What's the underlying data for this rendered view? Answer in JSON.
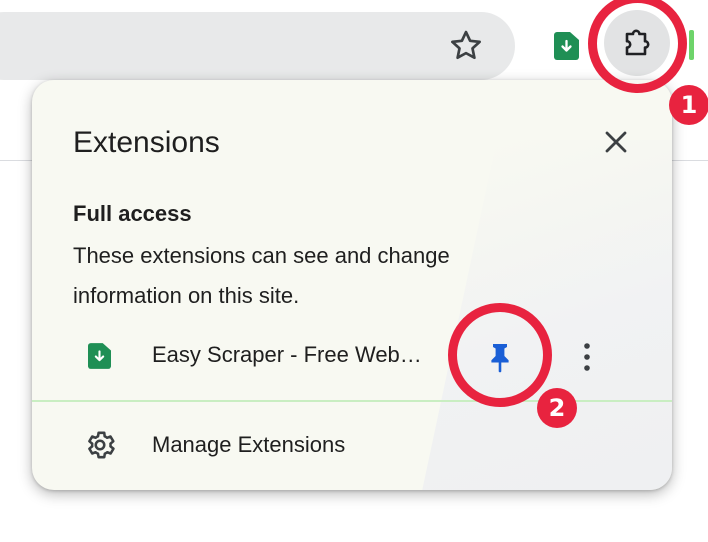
{
  "toolbar": {
    "bookmark_icon": "star-icon",
    "extension_icon": "easy-scraper-icon",
    "extensions_menu_icon": "puzzle-icon"
  },
  "popup": {
    "title": "Extensions",
    "close_icon": "close-icon",
    "section": {
      "heading": "Full access",
      "description": "These extensions can see and change information on this site."
    },
    "extensions": [
      {
        "name": "Easy Scraper - Free Web…",
        "icon": "easy-scraper-icon",
        "pin_icon": "pin-icon",
        "more_icon": "more-vert-icon"
      }
    ],
    "manage": {
      "label": "Manage Extensions",
      "icon": "gear-icon"
    }
  },
  "annotations": {
    "step1": "1",
    "step2": "2",
    "color": "#e8233f"
  },
  "colors": {
    "popup_background": "#f8f9f2",
    "extension_green": "#1f8f55",
    "pin_blue": "#1a5fd6",
    "divider_green": "#c9eec2"
  }
}
